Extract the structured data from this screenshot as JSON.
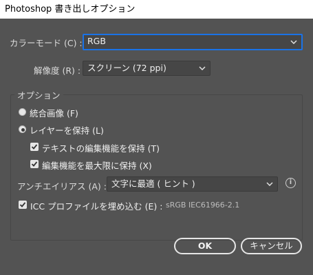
{
  "window": {
    "title": "Photoshop 書き出しオプション"
  },
  "color_mode": {
    "label": "カラーモード (C) :",
    "value": "RGB"
  },
  "resolution": {
    "label": "解像度 (R) :",
    "value": "スクリーン (72 ppi)"
  },
  "options": {
    "title": "オプション",
    "flatten_label": "統合画像 (F)",
    "flatten_selected": false,
    "keep_layers_label": "レイヤーを保持 (L)",
    "keep_layers_selected": true,
    "keep_text_label": "テキストの編集機能を保持 (T)",
    "keep_text_checked": true,
    "max_edit_label": "編集機能を最大限に保持 (X)",
    "max_edit_checked": true,
    "antialias_label": "アンチエイリアス (A) :",
    "antialias_value": "文字に最適 ( ヒント )",
    "icc_label": "ICC プロファイルを埋め込む (E) :",
    "icc_checked": true,
    "icc_profile": "sRGB IEC61966-2.1"
  },
  "buttons": {
    "ok": "OK",
    "cancel": "キャンセル"
  },
  "colors": {
    "background": "#535353",
    "focus": "#1a73e8",
    "field": "#464646"
  }
}
